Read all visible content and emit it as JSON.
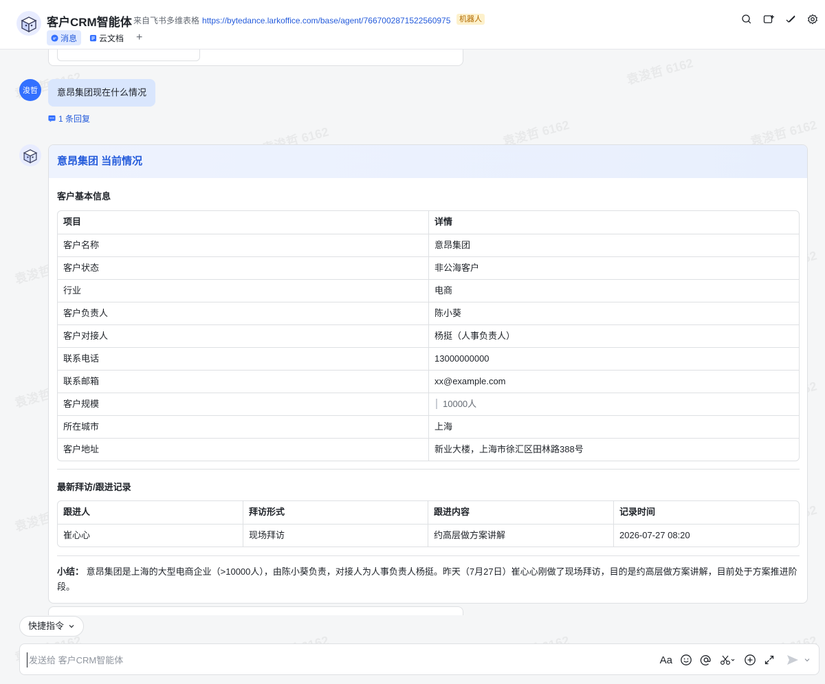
{
  "header": {
    "title": "客户CRM智能体",
    "source_prefix": "来自飞书多维表格",
    "source_link": "https://bytedance.larkoffice.com/base/agent/7667002871522560975",
    "badge": "机器人",
    "tabs": [
      {
        "label": "消息",
        "active": true
      },
      {
        "label": "云文档",
        "active": false
      }
    ],
    "add_tab": "+"
  },
  "chat": {
    "user_avatar_label": "浚哲",
    "user_message": "意昂集团现在什么情况",
    "reply_count": "1 条回复",
    "card": {
      "title": "意昂集团 当前情况",
      "basic_info_title": "客户基本信息",
      "basic_info_headers": [
        "项目",
        "详情"
      ],
      "basic_info_rows": [
        [
          "客户名称",
          "意昂集团"
        ],
        [
          "客户状态",
          "非公海客户"
        ],
        [
          "行业",
          "电商"
        ],
        [
          "客户负责人",
          "陈小葵"
        ],
        [
          "客户对接人",
          "杨挺（人事负责人）"
        ],
        [
          "联系电话",
          "13000000000"
        ],
        [
          "联系邮箱",
          "xx@example.com"
        ],
        [
          "客户规模",
          "10000人"
        ],
        [
          "所在城市",
          "上海"
        ],
        [
          "客户地址",
          "新业大楼，上海市徐汇区田林路388号"
        ]
      ],
      "visit_title": "最新拜访/跟进记录",
      "visit_headers": [
        "跟进人",
        "拜访形式",
        "跟进内容",
        "记录时间"
      ],
      "visit_rows": [
        [
          "崔心心",
          "现场拜访",
          "约高层做方案讲解",
          "2026-07-27 08:20"
        ]
      ],
      "summary_label": "小结：",
      "summary_text": "意昂集团是上海的大型电商企业（>10000人），由陈小葵负责，对接人为人事负责人杨挺。昨天（7月27日）崔心心刚做了现场拜访，目的是约高层做方案讲解，目前处于方案推进阶段。"
    }
  },
  "footer": {
    "quick_commands": "快捷指令",
    "input_placeholder": "发送给 客户CRM智能体",
    "format_label": "Aa"
  },
  "watermark": "袁浚哲 6162",
  "colors": {
    "accent": "#245bdb",
    "bubble": "#d9e6fd",
    "badge_bg": "#fdf1cc"
  }
}
